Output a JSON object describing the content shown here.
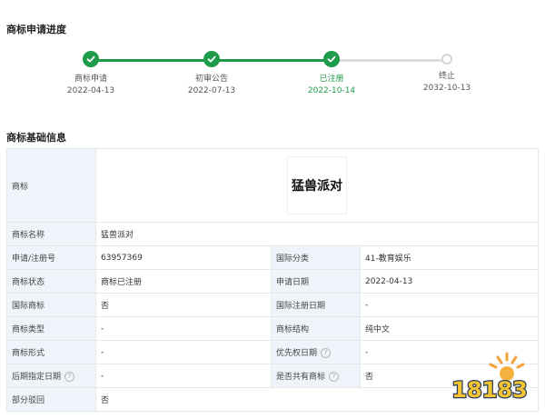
{
  "progress": {
    "title": "商标申请进度",
    "steps": [
      {
        "label": "商标申请",
        "date": "2022-04-13",
        "status": "done"
      },
      {
        "label": "初审公告",
        "date": "2022-07-13",
        "status": "done"
      },
      {
        "label": "已注册",
        "date": "2022-10-14",
        "status": "current"
      },
      {
        "label": "终止",
        "date": "2032-10-13",
        "status": "pending"
      }
    ],
    "accent_color": "#1e9b4b"
  },
  "basic": {
    "title": "商标基础信息",
    "mark_label": "商标",
    "mark_image_text": "猛兽派对",
    "name_label": "商标名称",
    "name_value": "猛兽派对",
    "rows": [
      {
        "k1": "申请/注册号",
        "v1": "63957369",
        "k2": "国际分类",
        "v2": "41-教育娱乐"
      },
      {
        "k1": "商标状态",
        "v1": "商标已注册",
        "k2": "申请日期",
        "v2": "2022-04-13"
      },
      {
        "k1": "国际商标",
        "v1": "否",
        "k2": "国际注册日期",
        "v2": "-"
      },
      {
        "k1": "商标类型",
        "v1": "-",
        "k2": "商标结构",
        "v2": "纯中文"
      },
      {
        "k1": "商标形式",
        "v1": "-",
        "k2": "优先权日期",
        "v2": "-"
      },
      {
        "k1": "后期指定日期",
        "v1": "-",
        "k2": "是否共有商标",
        "v2": "否"
      }
    ],
    "partial_label": "部分驳回",
    "partial_value": "否",
    "help_icon": "?"
  },
  "watermark": {
    "text": "18183"
  }
}
